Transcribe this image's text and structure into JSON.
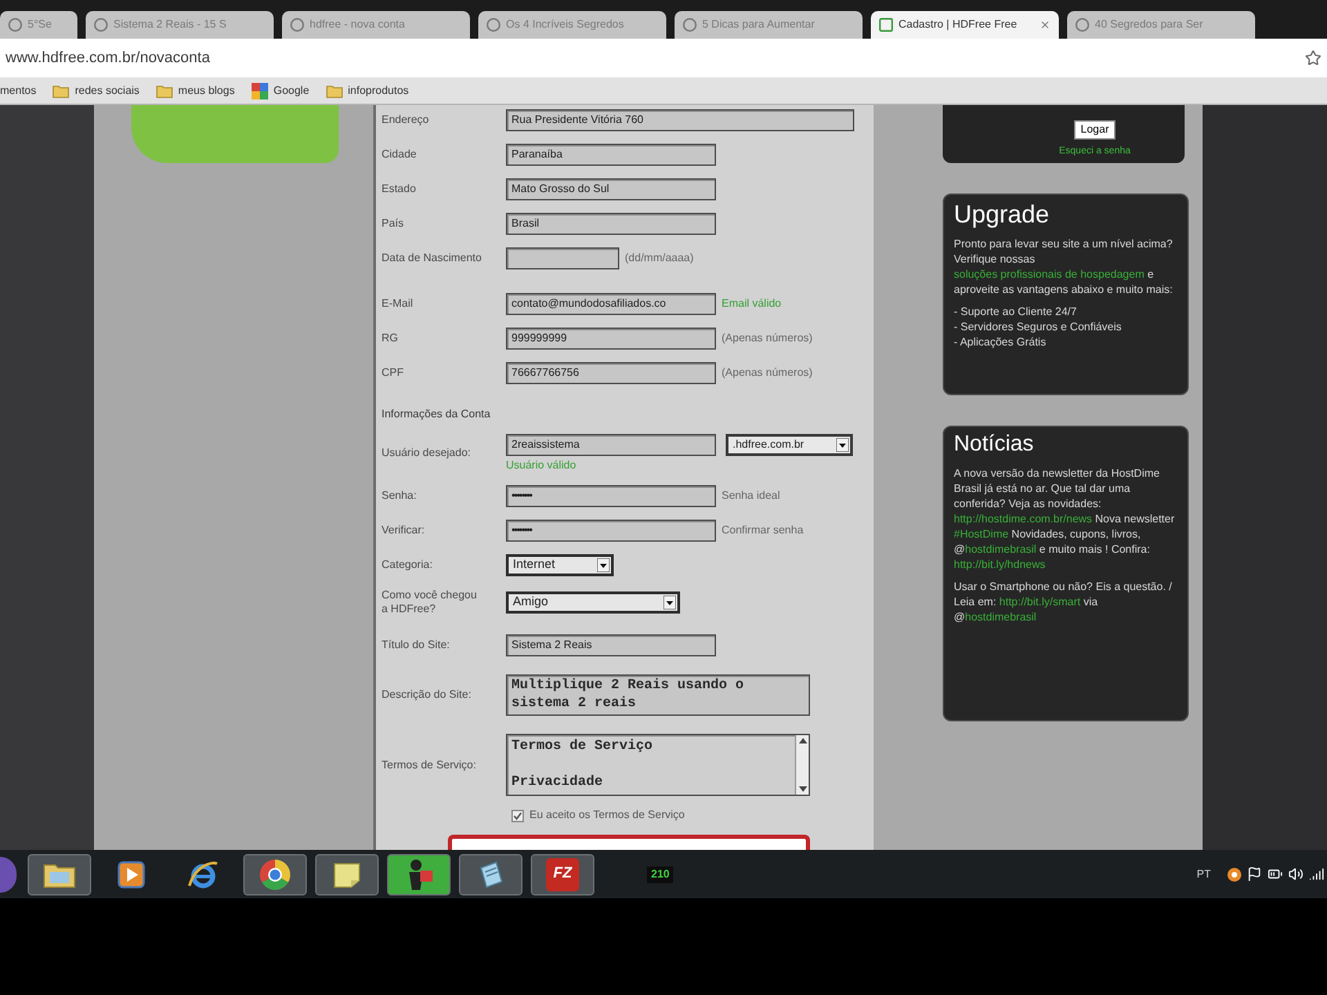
{
  "browser": {
    "tabs": [
      {
        "title": "5°Se",
        "selected": false
      },
      {
        "title": "Sistema 2 Reais - 15 S",
        "selected": false
      },
      {
        "title": "hdfree - nova conta",
        "selected": false
      },
      {
        "title": "Os 4 Incríveis Segredos",
        "selected": false
      },
      {
        "title": "5 Dicas para Aumentar",
        "selected": false
      },
      {
        "title": "Cadastro | HDFree Free",
        "selected": true
      },
      {
        "title": "40 Segredos para Ser",
        "selected": false
      }
    ],
    "address": "www.hdfree.com.br/novaconta",
    "bookmarks": [
      {
        "kind": "text",
        "label": "mentos"
      },
      {
        "kind": "folder",
        "label": "redes sociais"
      },
      {
        "kind": "folder",
        "label": "meus blogs"
      },
      {
        "kind": "google",
        "label": "Google"
      },
      {
        "kind": "folder",
        "label": "infoprodutos"
      }
    ]
  },
  "form": {
    "rows": [
      {
        "kind": "wide",
        "label": "Endereço",
        "value": "Rua Presidente Vitória 760"
      },
      {
        "kind": "text",
        "label": "Cidade",
        "value": "Paranaíba"
      },
      {
        "kind": "text",
        "label": "Estado",
        "value": "Mato Grosso do Sul"
      },
      {
        "kind": "text",
        "label": "País",
        "value": "Brasil"
      },
      {
        "kind": "short",
        "label": "Data de Nascimento",
        "hint": "(dd/mm/aaaa)"
      },
      {
        "kind": "text",
        "label": "E-Mail",
        "value": "contato@mundodosafiliados.co",
        "status": "Email válido"
      },
      {
        "kind": "text",
        "label": "RG",
        "value": "999999999",
        "hint": "(Apenas números)"
      },
      {
        "kind": "text",
        "label": "CPF",
        "value": "76667766756",
        "hint": "(Apenas números)"
      },
      {
        "kind": "heading",
        "label": "Informações da Conta"
      },
      {
        "kind": "domain",
        "label": "Usuário desejado:",
        "value": "2reaissistema",
        "suffix": ".hdfree.com.br",
        "status": "Usuário válido"
      },
      {
        "kind": "password",
        "label": "Senha:",
        "value": "••••••••",
        "hint": "Senha ideal"
      },
      {
        "kind": "password",
        "label": "Verificar:",
        "value": "••••••••",
        "hint": "Confirmar senha"
      },
      {
        "kind": "select",
        "label": "Categoria:",
        "value": "Internet"
      },
      {
        "kind": "select-wide",
        "label": "Como você chegou a HDFree?",
        "value": "Amigo"
      },
      {
        "kind": "text",
        "label": "Título do Site:",
        "value": "Sistema 2 Reais"
      },
      {
        "kind": "textarea",
        "label": "Descrição do Site:",
        "value": "Multiplique 2 Reais usando o sistema 2 reais"
      },
      {
        "kind": "scroll-box",
        "label": "Termos de Serviço:",
        "lines": [
          "Termos de Serviço",
          "Privacidade"
        ]
      },
      {
        "kind": "checkbox",
        "label": "Eu aceito os Termos de Serviço",
        "checked": true
      }
    ]
  },
  "sidebar": {
    "login": {
      "button": "Logar",
      "link": "Esqueci a senha"
    },
    "upgrade": {
      "title": "Upgrade",
      "text": [
        {
          "kind": "text",
          "text": "Pronto para levar seu site a um nível acima? Verifique nossas "
        },
        {
          "kind": "link",
          "text": "soluções profissionais de hospedagem"
        },
        {
          "kind": "text",
          "text": " e aproveite as vantagens abaixo e muito mais:"
        }
      ],
      "bullets": [
        "- Suporte ao Cliente 24/7",
        "- Servidores Seguros e Confiáveis",
        "- Aplicações Grátis"
      ]
    },
    "news": {
      "title": "Notícias",
      "paragraphs": [
        [
          {
            "kind": "text",
            "text": "A nova versão da newsletter da HostDime Brasil já está no ar. Que tal dar uma conferida? Veja as novidades: "
          },
          {
            "kind": "link",
            "text": "http://hostdime.com.br/news"
          },
          {
            "kind": "text",
            "text": " Nova newsletter "
          },
          {
            "kind": "link",
            "text": "#HostDime"
          },
          {
            "kind": "text",
            "text": " Novidades, cupons, livros, @"
          },
          {
            "kind": "link",
            "text": "hostdimebrasil"
          },
          {
            "kind": "text",
            "text": " e muito mais ! Confira: "
          },
          {
            "kind": "link",
            "text": "http://bit.ly/hdnews"
          }
        ],
        [
          {
            "kind": "text",
            "text": "Usar o Smartphone ou não? Eis a questão. / Leia em: "
          },
          {
            "kind": "link",
            "text": "http://bit.ly/smart"
          },
          {
            "kind": "text",
            "text": " via @"
          },
          {
            "kind": "link",
            "text": "hostdimebrasil"
          }
        ]
      ]
    }
  },
  "taskbar": {
    "apps": [
      {
        "kind": "folder",
        "running": true,
        "selected": false
      },
      {
        "kind": "media",
        "running": false,
        "selected": false
      },
      {
        "kind": "ring",
        "running": false,
        "selected": false
      },
      {
        "kind": "circle",
        "running": true,
        "selected": false
      },
      {
        "kind": "notes",
        "running": true,
        "selected": false
      },
      {
        "kind": "figure",
        "running": true,
        "selected": true
      },
      {
        "kind": "document",
        "running": true,
        "selected": false
      },
      {
        "kind": "logo",
        "running": true,
        "selected": false,
        "glyph": "FZ"
      }
    ],
    "meter": "210",
    "language": "PT"
  }
}
